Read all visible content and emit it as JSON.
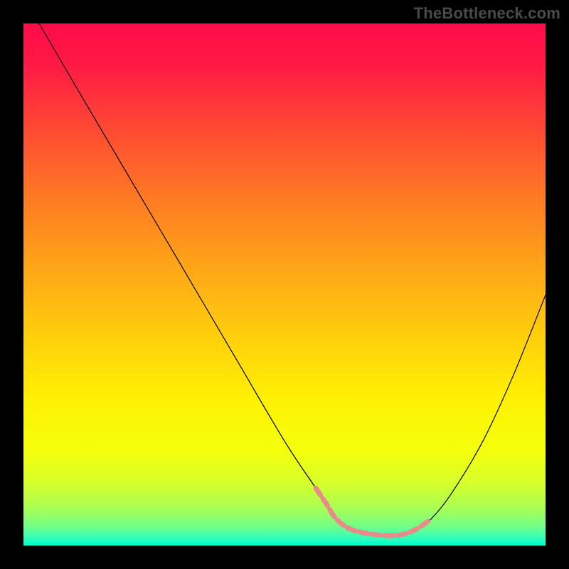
{
  "watermark": "TheBottleneck.com",
  "chart_data": {
    "type": "line",
    "title": "",
    "xlabel": "",
    "ylabel": "",
    "xlim": [
      0,
      100
    ],
    "ylim": [
      0,
      100
    ],
    "grid": false,
    "legend": false,
    "axis_visible": false,
    "background_gradient": {
      "stops": [
        {
          "offset": 0.0,
          "color": "#ff0b49"
        },
        {
          "offset": 0.08,
          "color": "#ff1a45"
        },
        {
          "offset": 0.2,
          "color": "#ff4933"
        },
        {
          "offset": 0.35,
          "color": "#ff7f22"
        },
        {
          "offset": 0.5,
          "color": "#ffb015"
        },
        {
          "offset": 0.62,
          "color": "#ffd50a"
        },
        {
          "offset": 0.72,
          "color": "#fff103"
        },
        {
          "offset": 0.82,
          "color": "#f4ff0c"
        },
        {
          "offset": 0.88,
          "color": "#d6ff2b"
        },
        {
          "offset": 0.93,
          "color": "#a8ff55"
        },
        {
          "offset": 0.965,
          "color": "#6fff8a"
        },
        {
          "offset": 0.985,
          "color": "#35ffb8"
        },
        {
          "offset": 1.0,
          "color": "#00ffcf"
        }
      ]
    },
    "series": [
      {
        "name": "bottleneck-curve",
        "color": "#000000",
        "width": 1.2,
        "x": [
          3,
          10,
          20,
          30,
          40,
          50,
          56,
          58,
          60,
          63,
          68,
          72,
          75,
          78,
          82,
          88,
          94,
          100
        ],
        "values": [
          100,
          88,
          71,
          54,
          37,
          20,
          11,
          8,
          5,
          3,
          2,
          2,
          3,
          5,
          10,
          20,
          33,
          48
        ]
      }
    ],
    "highlight_band": {
      "name": "optimal-zone-marker",
      "color": "#e78b8b",
      "width": 7,
      "x": [
        56,
        58,
        60,
        63,
        68,
        72,
        75,
        78
      ],
      "values": [
        11,
        8,
        5,
        3,
        2,
        2,
        3,
        5
      ]
    }
  }
}
